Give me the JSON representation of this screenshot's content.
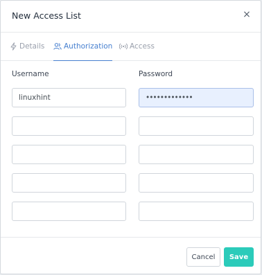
{
  "modal": {
    "title": "New Access List",
    "close_glyph": "×"
  },
  "tabs": [
    {
      "label": "Details",
      "icon": "bolt-icon",
      "active": false
    },
    {
      "label": "Authorization",
      "icon": "users-icon",
      "active": true
    },
    {
      "label": "Access",
      "icon": "radio-waves-icon",
      "active": false
    }
  ],
  "authorization": {
    "username_label": "Username",
    "password_label": "Password",
    "rows": [
      {
        "username": "linuxhint",
        "password": "•••••••••••••"
      },
      {
        "username": "",
        "password": ""
      },
      {
        "username": "",
        "password": ""
      },
      {
        "username": "",
        "password": ""
      },
      {
        "username": "",
        "password": ""
      }
    ]
  },
  "footer": {
    "cancel_label": "Cancel",
    "save_label": "Save"
  },
  "colors": {
    "accent": "#467fcf",
    "save": "#2bcbba"
  }
}
